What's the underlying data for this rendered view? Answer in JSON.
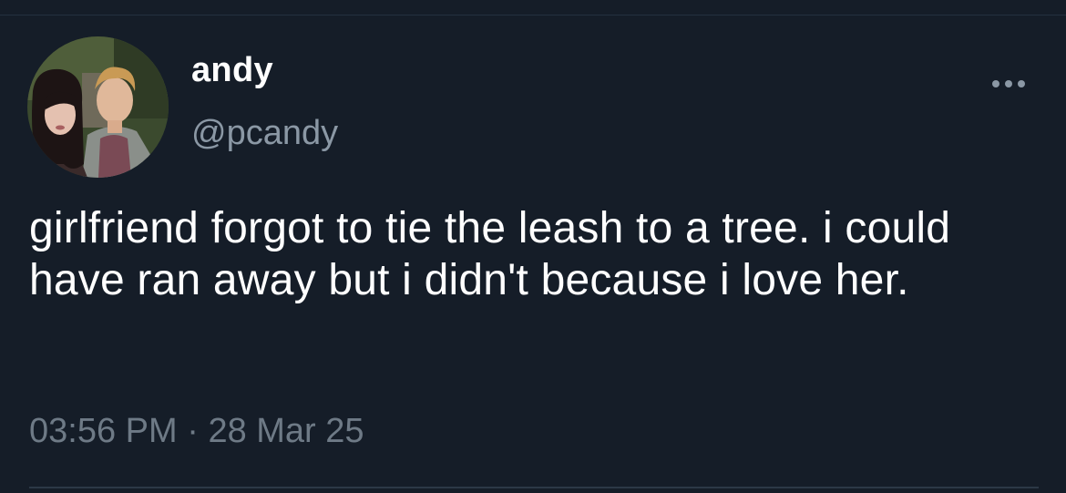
{
  "tweet": {
    "author": {
      "display_name": "andy",
      "handle": "@pcandy",
      "avatar_icon": "profile-photo"
    },
    "more_icon": "more-horizontal-icon",
    "text": "girlfriend forgot to tie the leash to a tree. i could have ran away but i didn't because i love her.",
    "time": "03:56 PM",
    "separator": "·",
    "date": "28 Mar 25"
  },
  "colors": {
    "background": "#151d28",
    "primary_text": "#ffffff",
    "secondary_text": "#8b98a5",
    "divider": "#2c3846"
  }
}
